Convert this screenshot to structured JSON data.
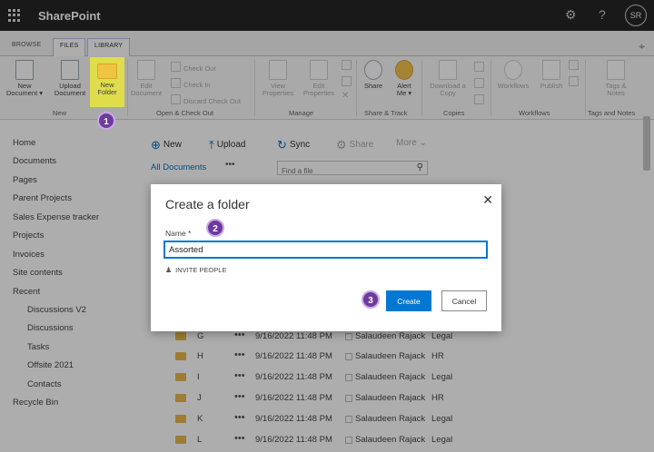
{
  "suite": {
    "app_name": "SharePoint",
    "settings_icon": "gear-icon",
    "help_label": "?",
    "user_initials": "SR"
  },
  "ribbon": {
    "tabs": [
      {
        "label": "BROWSE"
      },
      {
        "label": "FILES"
      },
      {
        "label": "LIBRARY"
      }
    ],
    "active_tab": "FILES",
    "buttons": {
      "new_document_l1": "New",
      "new_document_l2": "Document ▾",
      "upload_l1": "Upload",
      "upload_l2": "Document",
      "new_folder_l1": "New",
      "new_folder_l2": "Folder",
      "edit_document_l1": "Edit",
      "edit_document_l2": "Document",
      "check_out": "Check Out",
      "check_in": "Check In",
      "discard_check_out": "Discard Check Out",
      "view_properties_l1": "View",
      "view_properties_l2": "Properties",
      "edit_properties_l1": "Edit",
      "edit_properties_l2": "Properties",
      "share": "Share",
      "alert_me_l1": "Alert",
      "alert_me_l2": "Me ▾",
      "download_copy_l1": "Download a",
      "download_copy_l2": "Copy",
      "workflows": "Workflows",
      "publish": "Publish",
      "tags_notes_l1": "Tags &",
      "tags_notes_l2": "Notes"
    },
    "groups": {
      "new": "New",
      "open_checkout": "Open & Check Out",
      "manage": "Manage",
      "share_track": "Share & Track",
      "copies": "Copies",
      "workflows": "Workflows",
      "tags_notes": "Tags and Notes"
    }
  },
  "leftnav": {
    "items": [
      {
        "label": "Home"
      },
      {
        "label": "Documents"
      },
      {
        "label": "Pages"
      },
      {
        "label": "Parent Projects"
      },
      {
        "label": "Sales Expense tracker"
      },
      {
        "label": "Projects"
      },
      {
        "label": "Invoices"
      },
      {
        "label": "Site contents"
      },
      {
        "label": "Recent"
      },
      {
        "label": "Discussions V2"
      },
      {
        "label": "Discussions"
      },
      {
        "label": "Tasks"
      },
      {
        "label": "Offsite 2021"
      },
      {
        "label": "Contacts"
      },
      {
        "label": "Recycle Bin"
      }
    ]
  },
  "commandbar": {
    "new_label": "New",
    "upload_label": "Upload",
    "sync_label": "Sync",
    "share_label": "Share",
    "more_label": "More ⌄",
    "view_label": "All Documents",
    "view_dots": "•••",
    "find_placeholder": "Find a file"
  },
  "list": {
    "rows": [
      {
        "name": "G",
        "dots": "•••",
        "modified": "9/16/2022 11:48 PM",
        "user": "Salaudeen Rajack",
        "dept": "Legal"
      },
      {
        "name": "H",
        "dots": "•••",
        "modified": "9/16/2022 11:48 PM",
        "user": "Salaudeen Rajack",
        "dept": "HR"
      },
      {
        "name": "I",
        "dots": "•••",
        "modified": "9/16/2022 11:48 PM",
        "user": "Salaudeen Rajack",
        "dept": "Legal"
      },
      {
        "name": "J",
        "dots": "•••",
        "modified": "9/16/2022 11:48 PM",
        "user": "Salaudeen Rajack",
        "dept": "HR"
      },
      {
        "name": "K",
        "dots": "•••",
        "modified": "9/16/2022 11:48 PM",
        "user": "Salaudeen Rajack",
        "dept": "Legal"
      },
      {
        "name": "L",
        "dots": "•••",
        "modified": "9/16/2022 11:48 PM",
        "user": "Salaudeen Rajack",
        "dept": "Legal"
      }
    ]
  },
  "dialog": {
    "title": "Create a folder",
    "name_label": "Name *",
    "name_value": "Assorted",
    "invite_label": "INVITE PEOPLE",
    "create_label": "Create",
    "cancel_label": "Cancel",
    "close_glyph": "✕"
  },
  "steps": [
    "1",
    "2",
    "3"
  ],
  "colors": {
    "suite_bar": "#262626",
    "accent": "#0078d4",
    "step_badge": "#6d3b9c",
    "highlight": "#e9e63c",
    "folder": "#e8b84a"
  }
}
